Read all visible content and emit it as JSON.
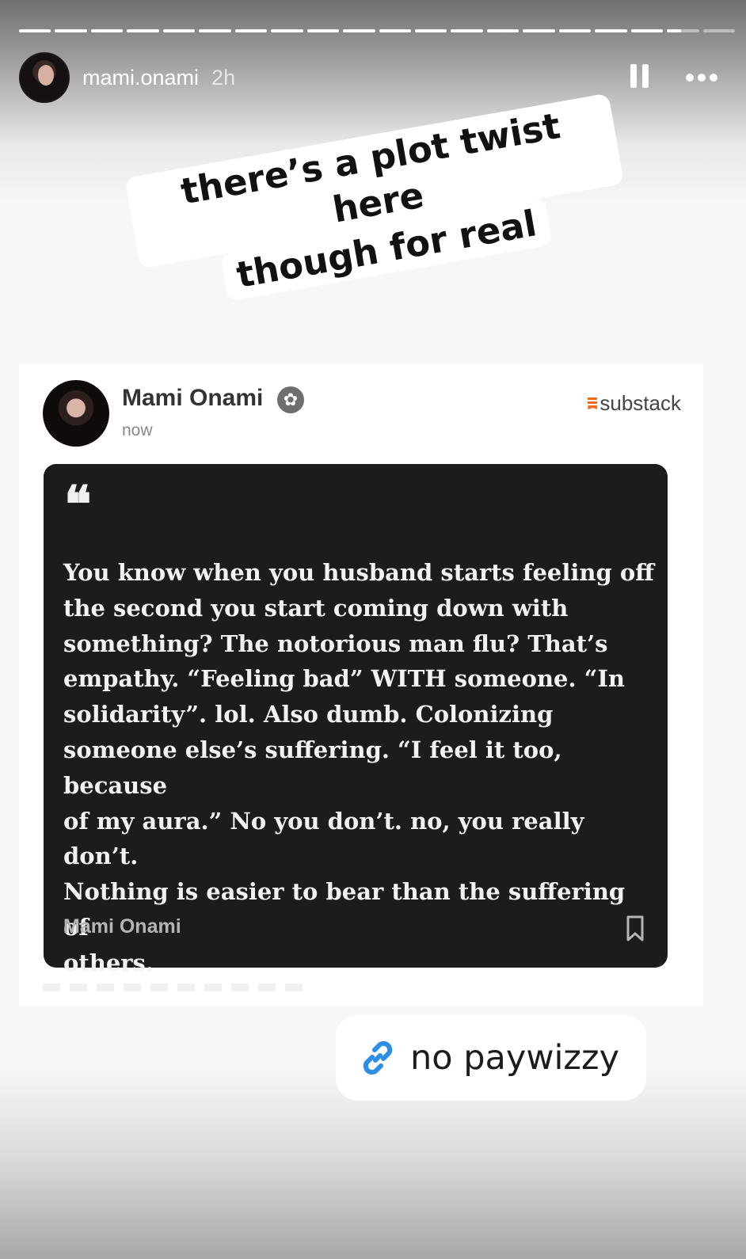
{
  "story": {
    "progress_segments": [
      1,
      1,
      1,
      1,
      1,
      1,
      1,
      1,
      1,
      1,
      1,
      1,
      1,
      1,
      1,
      1,
      1,
      1,
      0.45,
      0
    ],
    "username": "mami.onami",
    "time": "2h",
    "pause_icon": "pause-icon",
    "more_icon": "more-icon"
  },
  "sticker_text": {
    "line1": "there’s a plot twist here",
    "line2": "though for real"
  },
  "post": {
    "author_name": "Mami Onami",
    "badge_icon": "verified-badge-icon",
    "timestamp": "now",
    "source": "substack",
    "brand_color": "#ff6719",
    "quote_mark": "66",
    "quote_text": "You know when you husband starts feeling off\nthe second you start coming down with\nsomething? The notorious man flu? That’s\nempathy. “Feeling bad” WITH someone. “In\nsolidarity”. lol.  Also dumb. Colonizing\nsomeone else’s suffering. “I feel it too, because\nof my aura.” No you don’t.  no, you really don’t.\nNothing is easier to bear than the suffering of\nothers.",
    "quote_author": "Mami Onami",
    "bookmark_icon": "bookmark-icon"
  },
  "link_sticker": {
    "icon": "link-icon",
    "label": "no paywizzy",
    "icon_color": "#2d8ee8"
  }
}
